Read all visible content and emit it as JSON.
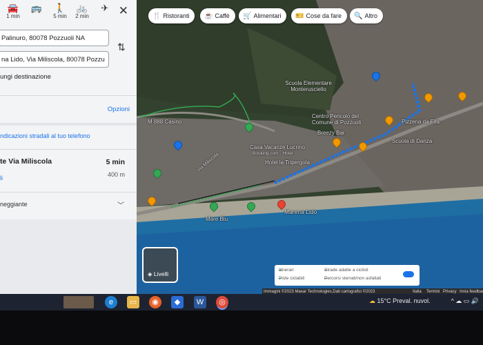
{
  "panel": {
    "modes": [
      {
        "icon": "car-icon",
        "glyph": "🚘",
        "label": "1 min"
      },
      {
        "icon": "bus-icon",
        "glyph": "🚌",
        "label": ""
      },
      {
        "icon": "walk-icon",
        "glyph": "🚶",
        "label": "5 min"
      },
      {
        "icon": "bike-icon",
        "glyph": "🚲",
        "label": "2 min"
      },
      {
        "icon": "plane-icon",
        "glyph": "✈",
        "label": ""
      }
    ],
    "close_glyph": "✕",
    "origin": "Palinuro, 80078 Pozzuoli NA",
    "destination": "na Lido, Via Miliscola, 80078 Pozzu",
    "add_destination": "ungi destinazione",
    "options": "Opzioni",
    "send_to_phone": "ndicazioni stradali al tuo telefono",
    "route": {
      "title": "te Via Miliscola",
      "time": "5 min",
      "distance": "400 m",
      "details": "li",
      "subtitle": "neggiante"
    }
  },
  "map": {
    "chips": [
      {
        "icon": "restaurant-icon",
        "glyph": "🍴",
        "label": "Ristoranti"
      },
      {
        "icon": "coffee-icon",
        "glyph": "☕",
        "label": "Caffè"
      },
      {
        "icon": "grocery-icon",
        "glyph": "🛒",
        "label": "Alimentari"
      },
      {
        "icon": "ticket-icon",
        "glyph": "🎫",
        "label": "Cose da fare"
      },
      {
        "icon": "search-icon",
        "glyph": "🔍",
        "label": "Altro"
      }
    ],
    "labels": [
      "Scuola Elementare Monterusciello",
      "Centro Pericolo del Comune di Pozzuoli",
      "Breezy Bar",
      "Casa Vacanze Lucrino",
      "Booking.com · Hotel",
      "Hotel la Tripergola",
      "Marena Lido",
      "Mare Blu",
      "Scuola di Danza",
      "Pizzeria da Fifa",
      "M 888 Casino",
      "Via Miliscola"
    ],
    "layers_label": "Livelli",
    "legend": {
      "routes": "Itinerari",
      "bike_lanes": "Piste ciclabili",
      "bike_roads": "Strade adatte a ciclisti",
      "dirt_paths": "Percorsi sterrati/non asfaltati"
    },
    "attribution": [
      "Immagini ©2023 Maxar Technologies,Dati cartografici ©2023",
      "Italia",
      "Termini",
      "Privacy",
      "Invia feedback"
    ]
  },
  "taskbar": {
    "weather": "15°C  Preval. nuvol.",
    "tray": "^  ☁  ▭  🔊"
  },
  "colors": {
    "route": "#1a73e8",
    "walk_trail": "#34a853",
    "accent": "#1a73e8"
  }
}
